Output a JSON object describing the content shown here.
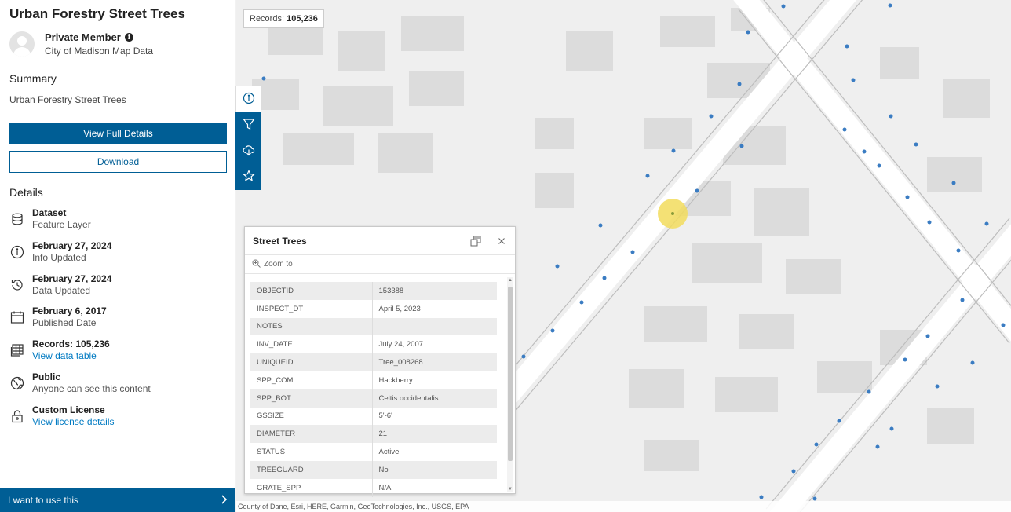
{
  "sidebar": {
    "title": "Urban Forestry Street Trees",
    "owner": {
      "name": "Private Member",
      "org": "City of Madison Map Data"
    },
    "summary_heading": "Summary",
    "summary_text": "Urban Forestry Street Trees",
    "view_full_details": "View Full Details",
    "download": "Download",
    "details_heading": "Details",
    "details": [
      {
        "icon": "database-icon",
        "title": "Dataset",
        "sub": "Feature Layer"
      },
      {
        "icon": "info-icon",
        "title": "February 27, 2024",
        "sub": "Info Updated"
      },
      {
        "icon": "history-icon",
        "title": "February 27, 2024",
        "sub": "Data Updated"
      },
      {
        "icon": "calendar-icon",
        "title": "February 6, 2017",
        "sub": "Published Date"
      },
      {
        "icon": "table-icon",
        "title": "Records: 105,236",
        "sub": "View data table"
      },
      {
        "icon": "globe-icon",
        "title": "Public",
        "sub": "Anyone can see this content"
      },
      {
        "icon": "lock-icon",
        "title": "Custom License",
        "sub": "View license details"
      }
    ],
    "want_to_use": "I want to use this"
  },
  "map": {
    "records_label": "Records:",
    "records_value": "105,236",
    "attribution": "County of Dane, Esri, HERE, Garmin, GeoTechnologies, Inc., USGS, EPA",
    "point_color": "#3a7cc2",
    "highlight_color": "#f2dc5d"
  },
  "toolbar": [
    "info-icon",
    "filter-icon",
    "cloud-download-icon",
    "star-icon"
  ],
  "popup": {
    "title": "Street Trees",
    "zoom_to": "Zoom to",
    "attributes": [
      {
        "key": "OBJECTID",
        "value": "153388"
      },
      {
        "key": "INSPECT_DT",
        "value": "April 5, 2023"
      },
      {
        "key": "NOTES",
        "value": ""
      },
      {
        "key": "INV_DATE",
        "value": "July 24, 2007"
      },
      {
        "key": "UNIQUEID",
        "value": "Tree_008268"
      },
      {
        "key": "SPP_COM",
        "value": "Hackberry"
      },
      {
        "key": "SPP_BOT",
        "value": "Celtis occidentalis"
      },
      {
        "key": "GSSIZE",
        "value": "5'-6'"
      },
      {
        "key": "DIAMETER",
        "value": "21"
      },
      {
        "key": "STATUS",
        "value": "Active"
      },
      {
        "key": "TREEGUARD",
        "value": "No"
      },
      {
        "key": "GRATE_SPP",
        "value": "N/A"
      }
    ]
  },
  "colors": {
    "accent": "#005e95",
    "link": "#007ac2"
  }
}
